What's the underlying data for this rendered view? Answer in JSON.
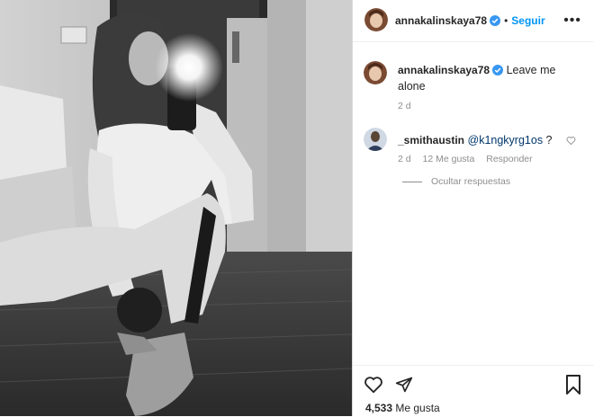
{
  "post": {
    "author": "annakalinskaya78",
    "follow_label": "Seguir",
    "caption": "Leave me alone",
    "caption_time": "2 d",
    "likes_count": "4,533",
    "likes_label": "Me gusta"
  },
  "comment": {
    "author": "_smithaustin",
    "mention": "@k1ngkyrg1os",
    "text": " ?",
    "time": "2 d",
    "likes": "12 Me gusta",
    "reply_label": "Responder",
    "hide_replies": "Ocultar respuestas"
  },
  "colors": {
    "accent": "#0095f6",
    "verified": "#3897f0",
    "text": "#262626",
    "muted": "#8e8e8e"
  }
}
